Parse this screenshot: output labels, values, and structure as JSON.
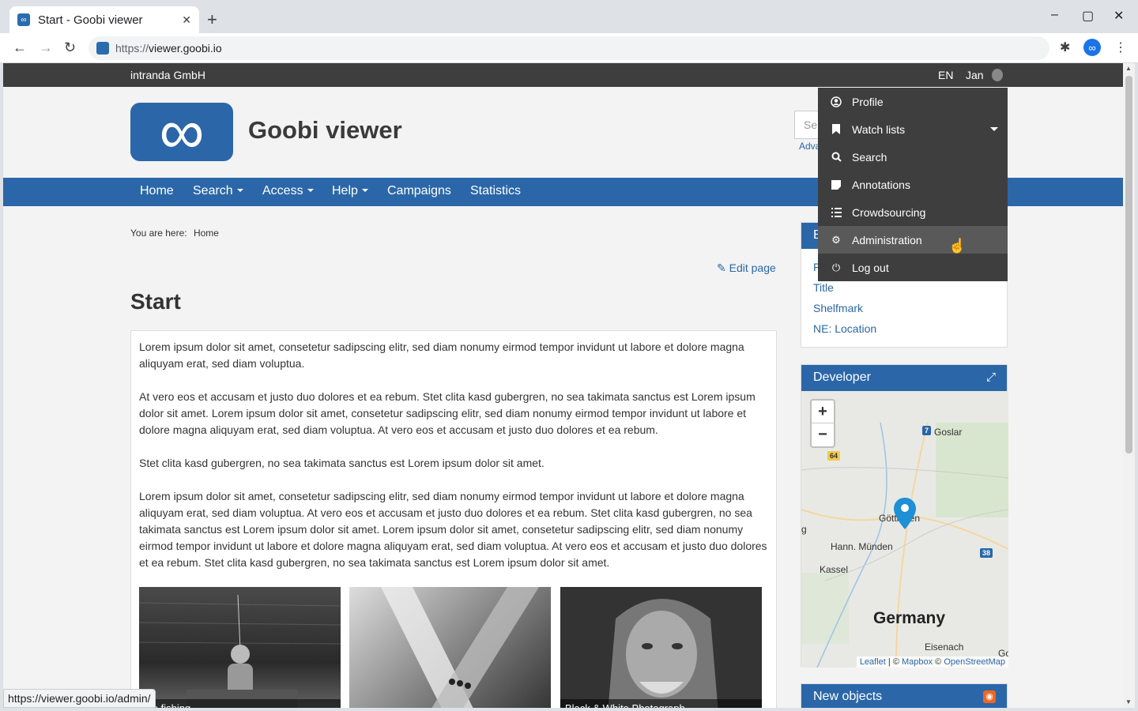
{
  "browser": {
    "tab_title": "Start - Goobi viewer",
    "tab_close": "✕",
    "new_tab": "+",
    "url_scheme": "https://",
    "url_host": "viewer.goobi.io",
    "status_url": "https://viewer.goobi.io/admin/",
    "window_minimize": "–",
    "window_maximize": "▢",
    "window_close": "✕"
  },
  "topbar": {
    "company": "intranda GmbH",
    "language": "EN",
    "user": "Jan"
  },
  "header": {
    "site_title": "Goobi viewer",
    "search_placeholder": "Se",
    "advanced_search": "Adva"
  },
  "nav": {
    "home": "Home",
    "search": "Search",
    "access": "Access",
    "help": "Help",
    "campaigns": "Campaigns",
    "statistics": "Statistics"
  },
  "breadcrumb": {
    "label": "You are here:",
    "current": "Home"
  },
  "page": {
    "edit_link": "Edit page",
    "heading": "Start",
    "paragraphs": [
      "Lorem ipsum dolor sit amet, consetetur sadipscing elitr, sed diam nonumy eirmod tempor invidunt ut labore et dolore magna aliquyam erat, sed diam voluptua.",
      "At vero eos et accusam et justo duo dolores et ea rebum. Stet clita kasd gubergren, no sea takimata sanctus est Lorem ipsum dolor sit amet. Lorem ipsum dolor sit amet, consetetur sadipscing elitr, sed diam nonumy eirmod tempor invidunt ut labore et dolore magna aliquyam erat, sed diam voluptua. At vero eos et accusam et justo duo dolores et ea rebum.",
      "Stet clita kasd gubergren, no sea takimata sanctus est Lorem ipsum dolor sit amet.",
      "Lorem ipsum dolor sit amet, consetetur sadipscing elitr, sed diam nonumy eirmod tempor invidunt ut labore et dolore magna aliquyam erat, sed diam voluptua. At vero eos et accusam et justo duo dolores et ea rebum. Stet clita kasd gubergren, no sea takimata sanctus est Lorem ipsum dolor sit amet. Lorem ipsum dolor sit amet, consetetur sadipscing elitr, sed diam nonumy eirmod tempor invidunt ut labore et dolore magna aliquyam erat, sed diam voluptua. At vero eos et accusam et justo duo dolores et ea rebum. Stet clita kasd gubergren, no sea takimata sanctus est Lorem ipsum dolor sit amet."
    ],
    "gallery_captions": [
      "...e fishing",
      "",
      "Black & White Photograph"
    ]
  },
  "sidebar": {
    "browse_head": "B",
    "browse_links": [
      "F",
      "Title",
      "Shelfmark",
      "NE: Location"
    ],
    "developer_head": "Developer",
    "map": {
      "zoom_in": "+",
      "zoom_out": "−",
      "labels": {
        "goslar": "Goslar",
        "gottingen": "Göttingen",
        "hann_munden": "Hann. Münden",
        "kassel": "Kassel",
        "germany": "Germany",
        "eisenach": "Eisenach",
        "go": "Go",
        "g": "g"
      },
      "shields": {
        "a7": "7",
        "b64": "64",
        "a38": "38"
      },
      "attribution_leaflet": "Leaflet",
      "attribution_sep": " | © ",
      "attribution_mapbox": "Mapbox",
      "attribution_copy": " © ",
      "attribution_osm": "OpenStreetMap"
    },
    "new_objects_head": "New objects"
  },
  "user_menu": {
    "items": [
      {
        "label": "Profile",
        "icon": "user-circle-icon"
      },
      {
        "label": "Watch lists",
        "icon": "bookmark-icon"
      },
      {
        "label": "Search",
        "icon": "search-icon"
      },
      {
        "label": "Annotations",
        "icon": "sticky-note-icon"
      },
      {
        "label": "Crowdsourcing",
        "icon": "list-icon"
      },
      {
        "label": "Administration",
        "icon": "cogs-icon"
      },
      {
        "label": "Log out",
        "icon": "power-icon"
      }
    ]
  },
  "colors": {
    "brand_blue": "#2b67a8",
    "topbar": "#3e3e3e",
    "menu_active": "#595959"
  }
}
